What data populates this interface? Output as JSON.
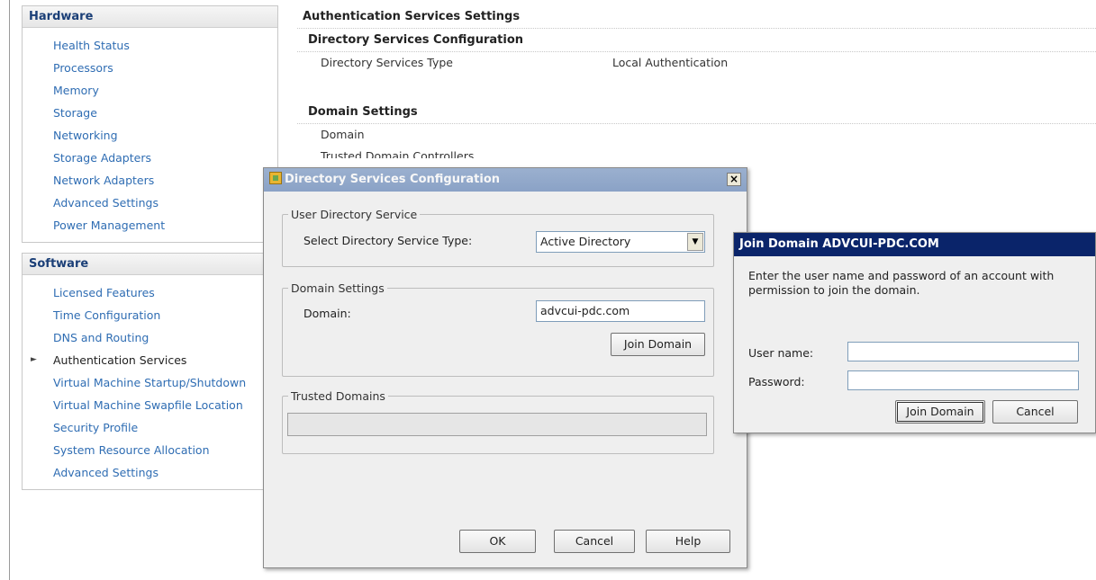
{
  "sidebar": {
    "hardware": {
      "header": "Hardware",
      "items": [
        "Health Status",
        "Processors",
        "Memory",
        "Storage",
        "Networking",
        "Storage Adapters",
        "Network Adapters",
        "Advanced Settings",
        "Power Management"
      ]
    },
    "software": {
      "header": "Software",
      "items": [
        "Licensed Features",
        "Time Configuration",
        "DNS and Routing",
        "Authentication Services",
        "Virtual Machine Startup/Shutdown",
        "Virtual Machine Swapfile Location",
        "Security Profile",
        "System Resource Allocation",
        "Advanced Settings"
      ],
      "active_index": 3
    }
  },
  "main": {
    "title": "Authentication Services Settings",
    "directory_config": {
      "heading": "Directory Services Configuration",
      "type_label": "Directory Services Type",
      "type_value": "Local Authentication"
    },
    "domain_settings": {
      "heading": "Domain Settings",
      "domain_label": "Domain",
      "trusted_label": "Trusted Domain Controllers"
    }
  },
  "dsc_dialog": {
    "title": "Directory Services Configuration",
    "close_label": "×",
    "user_directory_service": {
      "legend": "User Directory Service",
      "select_label": "Select Directory Service Type:",
      "selected_value": "Active Directory"
    },
    "domain_settings": {
      "legend": "Domain Settings",
      "domain_label": "Domain:",
      "domain_value": "advcui-pdc.com",
      "join_button": "Join Domain"
    },
    "trusted_domains": {
      "legend": "Trusted Domains"
    },
    "buttons": {
      "ok": "OK",
      "cancel": "Cancel",
      "help": "Help"
    }
  },
  "join_dialog": {
    "title": "Join Domain ADVCUI-PDC.COM",
    "message": "Enter the user name and password of an account with permission to join the domain.",
    "username_label": "User name:",
    "username_value": "",
    "password_label": "Password:",
    "password_value": "",
    "join_button": "Join Domain",
    "cancel_button": "Cancel"
  }
}
